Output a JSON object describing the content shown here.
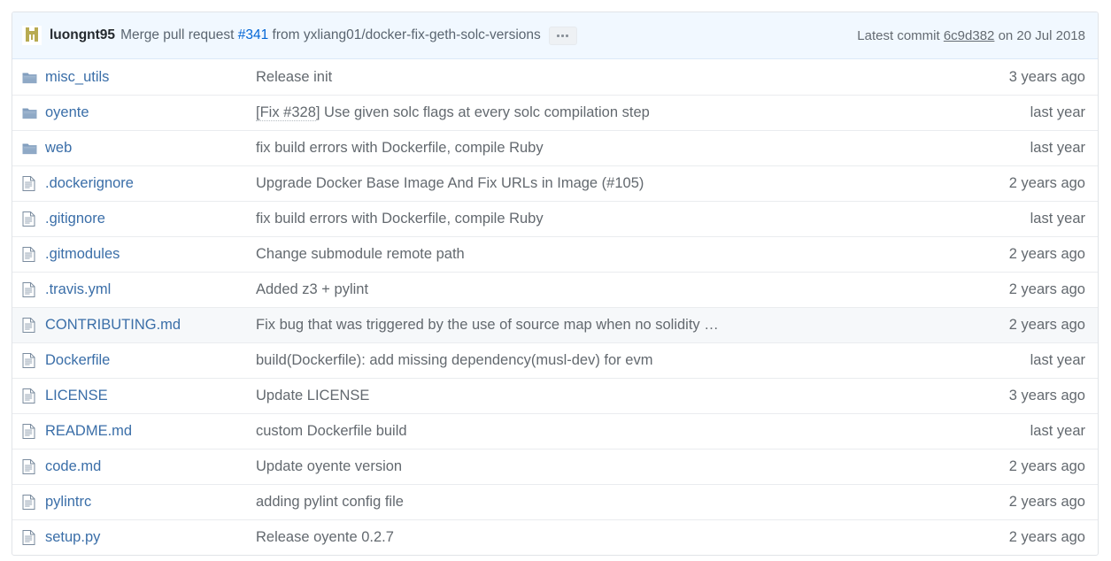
{
  "commit_header": {
    "avatar_alt": "luongnt95 avatar identicon",
    "author": "luongnt95",
    "message_prefix": "Merge pull request ",
    "pr_number": "#341",
    "message_suffix": " from yxliang01/docker-fix-geth-solc-versions",
    "expand_button_label": "…",
    "latest_commit_label": "Latest commit",
    "sha": "6c9d382",
    "date_text": "on 20 Jul 2018",
    "meta_full": "Latest commit 6c9d382 on 20 Jul 2018",
    "background_color": "#f1f8ff",
    "link_color": "#0366d6"
  },
  "colors": {
    "link": "#3a6ea8",
    "muted_text": "#63696f",
    "border": "#e1e4e8",
    "row_hover": "#f6f8fa",
    "folder_icon": "#7a96b8",
    "file_icon": "#6a7c91"
  },
  "files": [
    {
      "icon": "folder-icon",
      "type": "dir",
      "name": "misc_utils",
      "message": "Release init",
      "message_dotted": "",
      "age": "3 years ago",
      "hovered": false
    },
    {
      "icon": "folder-icon",
      "type": "dir",
      "name": "oyente",
      "message": "] Use given solc flags at every solc compilation step",
      "message_dotted": "[Fix #328",
      "age": "last year",
      "hovered": false
    },
    {
      "icon": "folder-icon",
      "type": "dir",
      "name": "web",
      "message": "fix build errors with Dockerfile, compile Ruby",
      "message_dotted": "",
      "age": "last year",
      "hovered": false
    },
    {
      "icon": "file-icon",
      "type": "file",
      "name": ".dockerignore",
      "message": "Upgrade Docker Base Image And Fix URLs in Image (#105)",
      "message_dotted": "",
      "age": "2 years ago",
      "hovered": false
    },
    {
      "icon": "file-icon",
      "type": "file",
      "name": ".gitignore",
      "message": "fix build errors with Dockerfile, compile Ruby",
      "message_dotted": "",
      "age": "last year",
      "hovered": false
    },
    {
      "icon": "file-icon",
      "type": "file",
      "name": ".gitmodules",
      "message": "Change submodule remote path",
      "message_dotted": "",
      "age": "2 years ago",
      "hovered": false
    },
    {
      "icon": "file-icon",
      "type": "file",
      "name": ".travis.yml",
      "message": "Added z3 + pylint",
      "message_dotted": "",
      "age": "2 years ago",
      "hovered": false
    },
    {
      "icon": "file-icon",
      "type": "file",
      "name": "CONTRIBUTING.md",
      "message": "Fix bug that was triggered by the use of source map when no solidity …",
      "message_dotted": "",
      "age": "2 years ago",
      "hovered": true
    },
    {
      "icon": "file-icon",
      "type": "file",
      "name": "Dockerfile",
      "message": "build(Dockerfile): add missing dependency(musl-dev) for evm",
      "message_dotted": "",
      "age": "last year",
      "hovered": false
    },
    {
      "icon": "file-icon",
      "type": "file",
      "name": "LICENSE",
      "message": "Update LICENSE",
      "message_dotted": "",
      "age": "3 years ago",
      "hovered": false
    },
    {
      "icon": "file-icon",
      "type": "file",
      "name": "README.md",
      "message": "custom Dockerfile build",
      "message_dotted": "",
      "age": "last year",
      "hovered": false
    },
    {
      "icon": "file-icon",
      "type": "file",
      "name": "code.md",
      "message": "Update oyente version",
      "message_dotted": "",
      "age": "2 years ago",
      "hovered": false
    },
    {
      "icon": "file-icon",
      "type": "file",
      "name": "pylintrc",
      "message": "adding pylint config file",
      "message_dotted": "",
      "age": "2 years ago",
      "hovered": false
    },
    {
      "icon": "file-icon",
      "type": "file",
      "name": "setup.py",
      "message": "Release oyente 0.2.7",
      "message_dotted": "",
      "age": "2 years ago",
      "hovered": false
    }
  ]
}
